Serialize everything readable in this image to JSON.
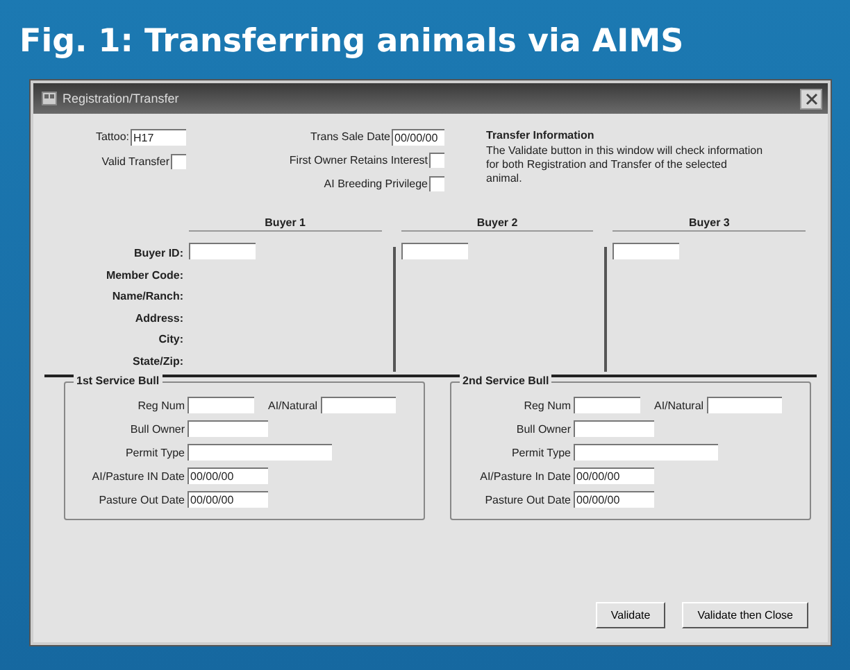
{
  "figure_title": "Fig. 1: Transferring animals via AIMS",
  "window": {
    "title": "Registration/Transfer"
  },
  "top_left": [
    {
      "kind": "field",
      "label": "Tattoo:",
      "value": "H17"
    },
    {
      "kind": "checkbox",
      "label": "Valid Transfer",
      "checked": false
    }
  ],
  "top_middle": [
    {
      "kind": "field",
      "label": "Trans Sale Date",
      "value": "00/00/00"
    },
    {
      "kind": "checkbox",
      "label": "First Owner Retains Interest",
      "checked": false
    },
    {
      "kind": "checkbox",
      "label": "AI Breeding Privilege",
      "checked": false
    }
  ],
  "transfer_info": {
    "heading": "Transfer Information",
    "text": "The Validate button in this window will check information for both Registration and Transfer of the selected animal."
  },
  "buyer_labels": [
    "Buyer ID:",
    "Member Code:",
    "Name/Ranch:",
    "Address:",
    "City:",
    "State/Zip:"
  ],
  "buyers": [
    {
      "heading": "Buyer 1"
    },
    {
      "heading": "Buyer 2"
    },
    {
      "heading": "Buyer 3"
    }
  ],
  "service_bulls": [
    {
      "title": "1st Service Bull",
      "reg_num_label": "Reg Num",
      "ai_natural_label": "AI/Natural",
      "bull_owner_label": "Bull Owner",
      "permit_type_label": "Permit Type",
      "in_date_label": "AI/Pasture IN Date",
      "in_date": "00/00/00",
      "out_date_label": "Pasture Out Date",
      "out_date": "00/00/00"
    },
    {
      "title": "2nd Service Bull",
      "reg_num_label": "Reg Num",
      "ai_natural_label": "AI/Natural",
      "bull_owner_label": "Bull Owner",
      "permit_type_label": "Permit Type",
      "in_date_label": "AI/Pasture In Date",
      "in_date": "00/00/00",
      "out_date_label": "Pasture Out Date",
      "out_date": "00/00/00"
    }
  ],
  "buttons": [
    "Validate",
    "Validate then Close"
  ]
}
